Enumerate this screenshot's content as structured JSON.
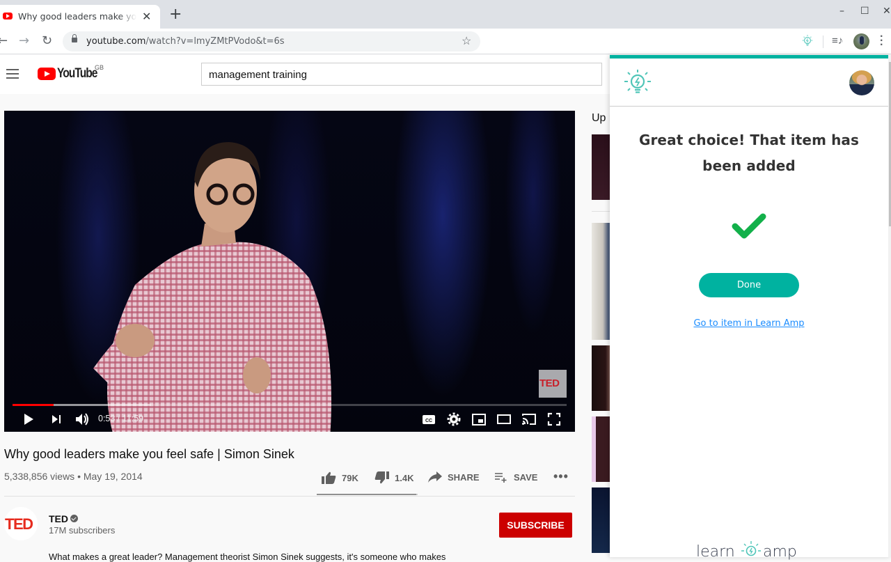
{
  "browser": {
    "tab_title": "Why good leaders make you feel safe | Simon Sinek - YouTube",
    "new_tab_icon": "plus-icon",
    "url_host": "youtube.com",
    "url_path": "/watch?v=lmyZMtPVodo&t=6s",
    "window_controls": {
      "minimize": "–",
      "maximize": "☐",
      "close": "✕"
    }
  },
  "youtube": {
    "logo_text": "YouTube",
    "country_code": "GB",
    "search_value": "management training",
    "video": {
      "current_time": "0:53",
      "duration": "11:59",
      "time_display": "0:53 / 11:59",
      "progress_fraction": 0.074,
      "buffered_fraction": 0.25,
      "watermark": "TED"
    },
    "title": "Why good leaders make you feel safe | Simon Sinek",
    "meta": "5,338,856 views • May 19, 2014",
    "actions": {
      "likes": "79K",
      "dislikes": "1.4K",
      "share": "SHARE",
      "save": "SAVE"
    },
    "like_ratio": 0.983,
    "channel": {
      "avatar_text": "TED",
      "name": "TED",
      "subscribers": "17M subscribers",
      "subscribe_label": "SUBSCRIBE"
    },
    "description": "What makes a great leader? Management theorist Simon Sinek suggests, it's someone who makes",
    "up_next_label": "Up next"
  },
  "learn_amp": {
    "heading": "Great choice! That item has been added",
    "done_label": "Done",
    "link_label": "Go to item in Learn Amp",
    "logo_left": "learn",
    "logo_right": "amp",
    "colors": {
      "brand": "#00b2a0",
      "check": "#12b04a",
      "link": "#1a8cff"
    }
  }
}
